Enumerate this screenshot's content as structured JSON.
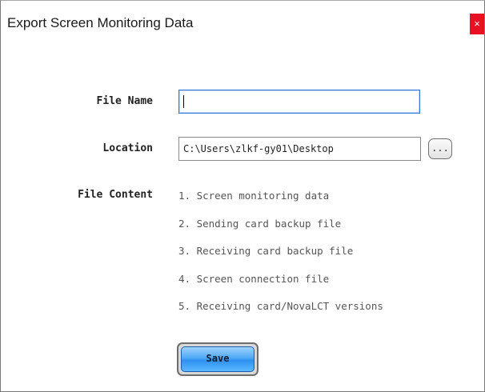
{
  "dialog": {
    "title": "Export Screen Monitoring Data",
    "close_glyph": "×",
    "accent_color": "#e81123"
  },
  "form": {
    "file_name_label": "File Name",
    "file_name_value": "",
    "location_label": "Location",
    "location_value": "C:\\Users\\zlkf-gy01\\Desktop",
    "browse_label": "...",
    "file_content_label": "File Content",
    "file_content_items": [
      "1. Screen monitoring data",
      "2. Sending card backup file",
      "3. Receiving card backup file",
      "4. Screen connection file",
      "5. Receiving card/NovaLCT versions"
    ]
  },
  "actions": {
    "save_label": "Save",
    "save_color": "#2d8ff0"
  },
  "icons": {
    "close": "close-icon"
  }
}
